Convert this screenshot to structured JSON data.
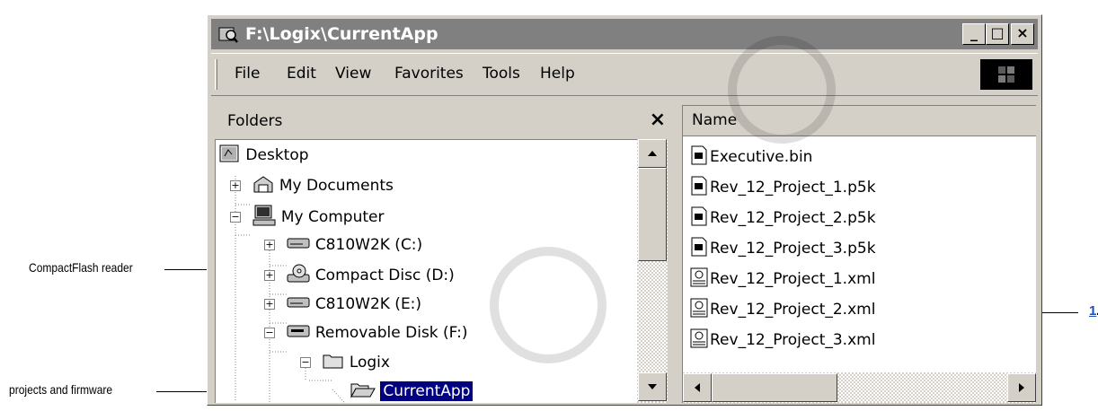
{
  "window": {
    "title": "F:\\Logix\\CurrentApp",
    "caption_buttons": [
      "_",
      "□",
      "×"
    ]
  },
  "menubar": {
    "items": [
      "File",
      "Edit",
      "View",
      "Favorites",
      "Tools",
      "Help"
    ]
  },
  "folders_pane": {
    "title": "Folders",
    "close_glyph": "×",
    "tree": [
      {
        "label": "Desktop",
        "icon": "desktop-icon",
        "expander": ""
      },
      {
        "label": "My Documents",
        "icon": "my-documents-icon",
        "expander": "+"
      },
      {
        "label": "My Computer",
        "icon": "computer-icon",
        "expander": "−"
      },
      {
        "label": "C810W2K (C:)",
        "icon": "hard-drive-icon",
        "expander": "+"
      },
      {
        "label": "Compact Disc (D:)",
        "icon": "cd-drive-icon",
        "expander": "+"
      },
      {
        "label": "C810W2K (E:)",
        "icon": "hard-drive-icon",
        "expander": "+"
      },
      {
        "label": "Removable Disk (F:)",
        "icon": "removable-disk-icon",
        "expander": "−"
      },
      {
        "label": "Logix",
        "icon": "folder-icon",
        "expander": "−"
      },
      {
        "label": "CurrentApp",
        "icon": "open-folder-icon",
        "expander": "",
        "selected": true
      }
    ]
  },
  "file_pane": {
    "column_header": "Name",
    "files": [
      {
        "name": "Executive.bin",
        "icon": "binary-file-icon"
      },
      {
        "name": "Rev_12_Project_1.p5k",
        "icon": "binary-file-icon"
      },
      {
        "name": "Rev_12_Project_2.p5k",
        "icon": "binary-file-icon"
      },
      {
        "name": "Rev_12_Project_3.p5k",
        "icon": "binary-file-icon"
      },
      {
        "name": "Rev_12_Project_1.xml",
        "icon": "xml-file-icon"
      },
      {
        "name": "Rev_12_Project_2.xml",
        "icon": "xml-file-icon"
      },
      {
        "name": "Rev_12_Project_3.xml",
        "icon": "xml-file-icon"
      }
    ]
  },
  "callouts": {
    "compactflash": "CompactFlash reader",
    "projects": "projects and firmware",
    "step_number": "1",
    "step_suffix": "."
  },
  "colors": {
    "titlebar": "#808080",
    "selection": "#000080",
    "step_link": "#1a4fbf"
  }
}
